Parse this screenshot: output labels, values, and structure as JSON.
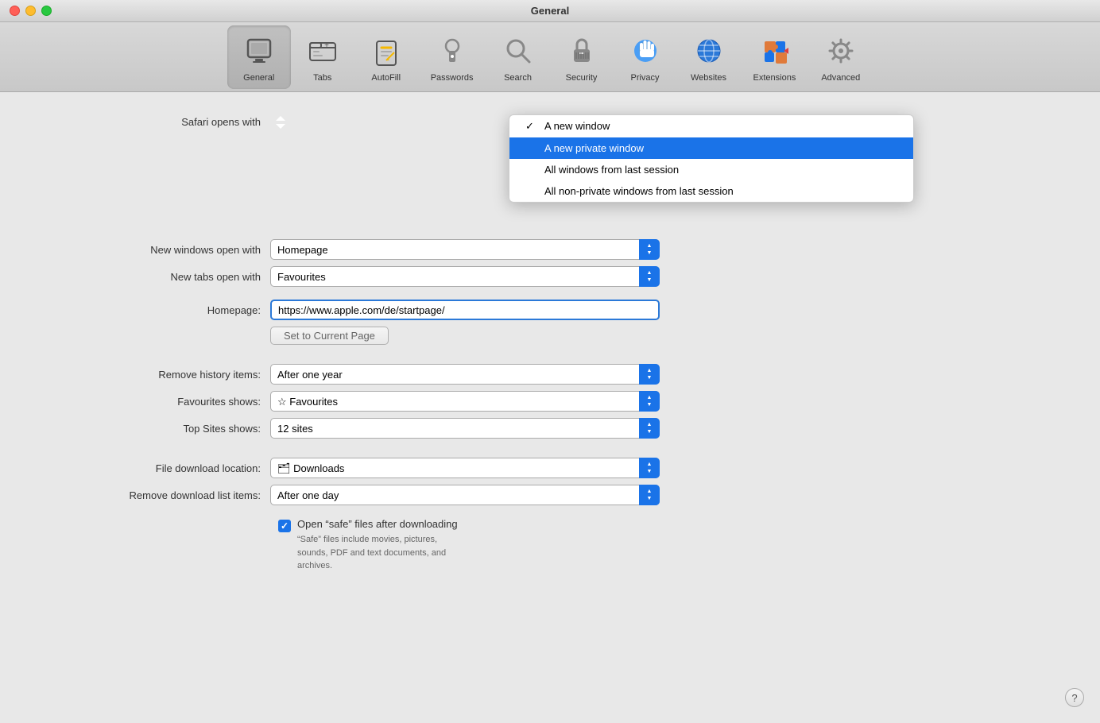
{
  "window": {
    "title": "General"
  },
  "toolbar": {
    "items": [
      {
        "id": "general",
        "label": "General",
        "icon": "general",
        "active": true
      },
      {
        "id": "tabs",
        "label": "Tabs",
        "icon": "tabs",
        "active": false
      },
      {
        "id": "autofill",
        "label": "AutoFill",
        "icon": "autofill",
        "active": false
      },
      {
        "id": "passwords",
        "label": "Passwords",
        "icon": "passwords",
        "active": false
      },
      {
        "id": "search",
        "label": "Search",
        "icon": "search",
        "active": false
      },
      {
        "id": "security",
        "label": "Security",
        "icon": "security",
        "active": false
      },
      {
        "id": "privacy",
        "label": "Privacy",
        "icon": "privacy",
        "active": false
      },
      {
        "id": "websites",
        "label": "Websites",
        "icon": "websites",
        "active": false
      },
      {
        "id": "extensions",
        "label": "Extensions",
        "icon": "extensions",
        "active": false
      },
      {
        "id": "advanced",
        "label": "Advanced",
        "icon": "advanced",
        "active": false
      }
    ]
  },
  "form": {
    "safari_opens_with_label": "Safari opens with",
    "new_windows_open_with_label": "New windows open with",
    "new_tabs_open_with_label": "New tabs open with",
    "homepage_label": "Homepage:",
    "homepage_value": "https://www.apple.com/de/startpage/",
    "set_current_page_label": "Set to Current Page",
    "remove_history_label": "Remove history items:",
    "remove_history_value": "After one year",
    "favourites_shows_label": "Favourites shows:",
    "favourites_shows_value": "Favourites",
    "top_sites_label": "Top Sites shows:",
    "top_sites_value": "12 sites",
    "file_download_label": "File download location:",
    "file_download_value": "Downloads",
    "remove_download_label": "Remove download list items:",
    "remove_download_value": "After one day",
    "open_safe_files_label": "Open “safe” files after downloading",
    "open_safe_files_sub": "“Safe” files include movies, pictures,\nsounds, PDF and text documents, and\narchives."
  },
  "dropdown_popup": {
    "items": [
      {
        "label": "A new window",
        "checked": true
      },
      {
        "label": "A new private window",
        "checked": false,
        "selected": true
      },
      {
        "label": "All windows from last session",
        "checked": false
      },
      {
        "label": "All non-private windows from last session",
        "checked": false
      }
    ]
  },
  "help": "?"
}
